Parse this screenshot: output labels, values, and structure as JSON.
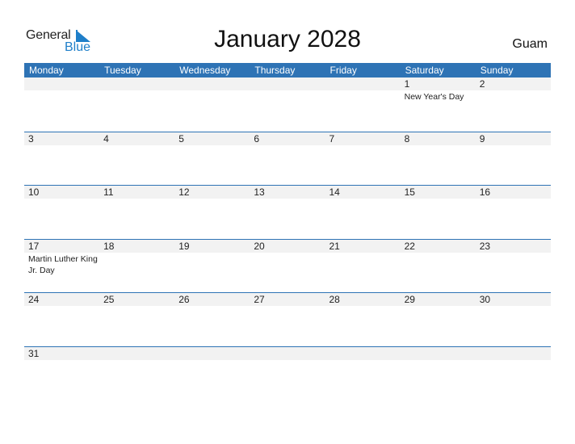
{
  "logo": {
    "general": "General",
    "blue": "Blue"
  },
  "title": "January 2028",
  "country": "Guam",
  "colors": {
    "header": "#2e73b5",
    "accent": "#1f7fc9",
    "date_strip": "#f2f2f2"
  },
  "weekdays": [
    "Monday",
    "Tuesday",
    "Wednesday",
    "Thursday",
    "Friday",
    "Saturday",
    "Sunday"
  ],
  "weeks": [
    {
      "days": [
        {
          "num": "",
          "event": ""
        },
        {
          "num": "",
          "event": ""
        },
        {
          "num": "",
          "event": ""
        },
        {
          "num": "",
          "event": ""
        },
        {
          "num": "",
          "event": ""
        },
        {
          "num": "1",
          "event": "New Year's Day"
        },
        {
          "num": "2",
          "event": ""
        }
      ]
    },
    {
      "days": [
        {
          "num": "3",
          "event": ""
        },
        {
          "num": "4",
          "event": ""
        },
        {
          "num": "5",
          "event": ""
        },
        {
          "num": "6",
          "event": ""
        },
        {
          "num": "7",
          "event": ""
        },
        {
          "num": "8",
          "event": ""
        },
        {
          "num": "9",
          "event": ""
        }
      ]
    },
    {
      "days": [
        {
          "num": "10",
          "event": ""
        },
        {
          "num": "11",
          "event": ""
        },
        {
          "num": "12",
          "event": ""
        },
        {
          "num": "13",
          "event": ""
        },
        {
          "num": "14",
          "event": ""
        },
        {
          "num": "15",
          "event": ""
        },
        {
          "num": "16",
          "event": ""
        }
      ]
    },
    {
      "days": [
        {
          "num": "17",
          "event": "Martin Luther King Jr. Day"
        },
        {
          "num": "18",
          "event": ""
        },
        {
          "num": "19",
          "event": ""
        },
        {
          "num": "20",
          "event": ""
        },
        {
          "num": "21",
          "event": ""
        },
        {
          "num": "22",
          "event": ""
        },
        {
          "num": "23",
          "event": ""
        }
      ]
    },
    {
      "days": [
        {
          "num": "24",
          "event": ""
        },
        {
          "num": "25",
          "event": ""
        },
        {
          "num": "26",
          "event": ""
        },
        {
          "num": "27",
          "event": ""
        },
        {
          "num": "28",
          "event": ""
        },
        {
          "num": "29",
          "event": ""
        },
        {
          "num": "30",
          "event": ""
        }
      ]
    },
    {
      "days": [
        {
          "num": "31",
          "event": ""
        },
        {
          "num": "",
          "event": ""
        },
        {
          "num": "",
          "event": ""
        },
        {
          "num": "",
          "event": ""
        },
        {
          "num": "",
          "event": ""
        },
        {
          "num": "",
          "event": ""
        },
        {
          "num": "",
          "event": ""
        }
      ]
    }
  ]
}
